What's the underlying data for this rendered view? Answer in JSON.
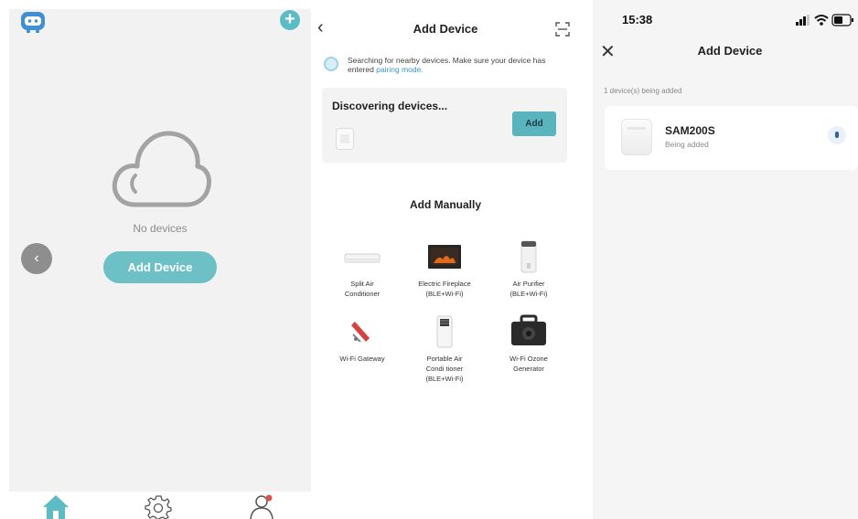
{
  "home": {
    "empty_text": "No devices",
    "add_button": "Add Device",
    "back_glyph": "‹",
    "plus_glyph": "+",
    "icons": [
      "robot-icon",
      "plus-icon",
      "cloud-icon",
      "back-icon",
      "home-icon",
      "settings-icon",
      "profile-icon"
    ]
  },
  "add": {
    "back_glyph": "‹",
    "title": "Add Device",
    "search_text": "Searching for nearby devices. Make sure your device has entered",
    "search_link": "pairing mode.",
    "discover_title": "Discovering devices...",
    "add_button": "Add",
    "manual_title": "Add Manually",
    "devices": [
      {
        "line1": "Split Air",
        "line2": "Conditioner",
        "line3": "",
        "icon": "split-ac-icon"
      },
      {
        "line1": "Electric Fireplace",
        "line2": "(BLE+Wi-Fi)",
        "line3": "",
        "icon": "fireplace-icon"
      },
      {
        "line1": "Air Purifier",
        "line2": "(BLE+Wi-Fi)",
        "line3": "",
        "icon": "air-purifier-icon"
      },
      {
        "line1": "Wi-Fi Gateway",
        "line2": "",
        "line3": "",
        "icon": "gateway-icon"
      },
      {
        "line1": "Portable Air",
        "line2": "Condi tioner",
        "line3": "(BLE+Wi-Fi)",
        "icon": "portable-ac-icon"
      },
      {
        "line1": "Wi-Fi Ozone",
        "line2": "Generator",
        "line3": "",
        "icon": "ozone-generator-icon"
      }
    ]
  },
  "adding": {
    "time": "15:38",
    "close_glyph": "✕",
    "title": "Add Device",
    "count_text": "1 device(s) being added",
    "device_name": "SAM200S",
    "device_status": "Being added"
  },
  "colors": {
    "accent": "#5bbcc4",
    "link": "#3a94c6",
    "home_tab": "#5bbcc4"
  }
}
